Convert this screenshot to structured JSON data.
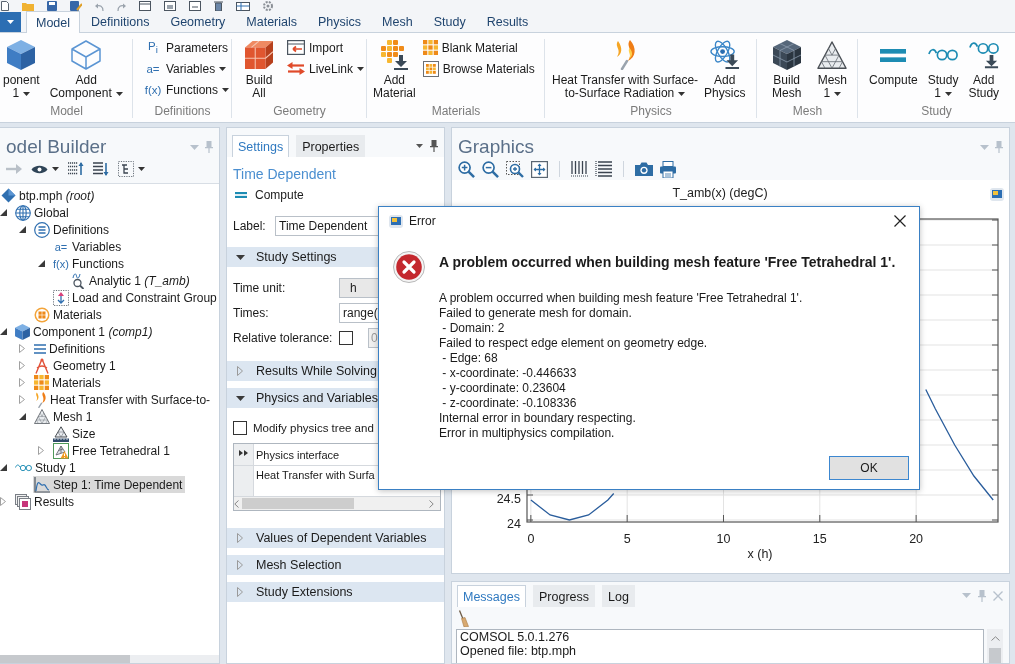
{
  "ribbon_tabs": [
    {
      "label": "Model",
      "selected": true
    },
    {
      "label": "Definitions",
      "selected": false
    },
    {
      "label": "Geometry",
      "selected": false
    },
    {
      "label": "Materials",
      "selected": false
    },
    {
      "label": "Physics",
      "selected": false
    },
    {
      "label": "Mesh",
      "selected": false
    },
    {
      "label": "Study",
      "selected": false
    },
    {
      "label": "Results",
      "selected": false
    }
  ],
  "ribbon_groups": [
    {
      "label": "Model",
      "items": [
        {
          "kind": "large",
          "lines": [
            "ponent",
            "1"
          ],
          "dropdown": true
        },
        {
          "kind": "large",
          "lines": [
            "Add",
            "Component"
          ],
          "dropdown": true
        }
      ]
    },
    {
      "label": "Definitions",
      "items": [
        {
          "kind": "stack",
          "buttons": [
            {
              "symbol": "P$_{i}$",
              "label": "Parameters",
              "dropdown": false
            },
            {
              "symbol": "a=",
              "label": "Variables",
              "dropdown": true
            },
            {
              "symbol": "f(x)",
              "label": "Functions",
              "dropdown": true
            }
          ]
        }
      ]
    },
    {
      "label": "Geometry",
      "items": [
        {
          "kind": "large",
          "lines": [
            "Build",
            "All"
          ],
          "dropdown": false
        },
        {
          "kind": "stack",
          "buttons": [
            {
              "label": "Import",
              "dropdown": false
            },
            {
              "label": "LiveLink",
              "dropdown": true
            }
          ]
        }
      ]
    },
    {
      "label": "Materials",
      "items": [
        {
          "kind": "large",
          "lines": [
            "Add",
            "Material"
          ],
          "dropdown": false
        },
        {
          "kind": "stack",
          "buttons": [
            {
              "label": "Blank Material",
              "dropdown": false
            },
            {
              "label": "Browse Materials",
              "dropdown": false
            }
          ]
        }
      ]
    },
    {
      "label": "Physics",
      "items": [
        {
          "kind": "large",
          "lines": [
            "Heat Transfer with Surface-",
            "to-Surface Radiation"
          ],
          "dropdown": true
        },
        {
          "kind": "large",
          "lines": [
            "Add",
            "Physics"
          ],
          "dropdown": false
        }
      ]
    },
    {
      "label": "Mesh",
      "items": [
        {
          "kind": "large",
          "lines": [
            "Build",
            "Mesh"
          ],
          "dropdown": false
        },
        {
          "kind": "large",
          "lines": [
            "Mesh",
            "1"
          ],
          "dropdown": true
        }
      ]
    },
    {
      "label": "Study",
      "items": [
        {
          "kind": "large",
          "lines": [
            "Compute"
          ],
          "dropdown": false
        },
        {
          "kind": "large",
          "lines": [
            "Study",
            "1"
          ],
          "dropdown": true
        },
        {
          "kind": "large",
          "lines": [
            "Add",
            "Study"
          ],
          "dropdown": false
        }
      ]
    }
  ],
  "model_builder": {
    "title": "odel Builder",
    "tree": [
      {
        "label": "btp.mph *(root)*",
        "kind": "file",
        "selected": false,
        "children": [
          {
            "label": "Global",
            "kind": "global",
            "expanded": true,
            "selected": false,
            "children": [
              {
                "label": "Definitions",
                "kind": "global_definitions",
                "expanded": true,
                "selected": false,
                "children": [
                  {
                    "label": "Variables",
                    "symbol": "a=",
                    "kind": "variables",
                    "selected": false
                  },
                  {
                    "label": "Functions",
                    "symbol": "f(x)",
                    "kind": "functions",
                    "expanded": true,
                    "selected": false,
                    "children": [
                      {
                        "label": "Analytic 1 *(T_amb)*",
                        "kind": "analytic",
                        "selected": false
                      }
                    ]
                  },
                  {
                    "label": "Load and Constraint Group",
                    "kind": "load_group",
                    "selected": false
                  }
                ]
              },
              {
                "label": "Materials",
                "kind": "global_materials",
                "selected": false
              }
            ]
          },
          {
            "label": "Component 1 *(comp1)*",
            "kind": "component",
            "expanded": true,
            "selected": false,
            "children": [
              {
                "label": "Definitions",
                "kind": "definitions",
                "expanded": false,
                "selected": false
              },
              {
                "label": "Geometry 1",
                "kind": "geometry",
                "expanded": false,
                "selected": false
              },
              {
                "label": "Materials",
                "kind": "materials",
                "expanded": false,
                "selected": false
              },
              {
                "label": "Heat Transfer with Surface-to-",
                "kind": "physics",
                "expanded": false,
                "selected": false
              },
              {
                "label": "Mesh 1",
                "kind": "mesh",
                "expanded": true,
                "selected": false,
                "children": [
                  {
                    "label": "Size",
                    "kind": "size",
                    "selected": false
                  },
                  {
                    "label": "Free Tetrahedral 1",
                    "kind": "free_tetrahedral",
                    "expanded": false,
                    "selected": false
                  }
                ]
              }
            ]
          },
          {
            "label": "Study 1",
            "kind": "study",
            "expanded": true,
            "selected": false,
            "children": [
              {
                "label": "Step 1: Time Dependent",
                "kind": "study_step",
                "selected": true
              }
            ]
          },
          {
            "label": "Results",
            "kind": "results",
            "expanded": false,
            "selected": false
          }
        ]
      }
    ]
  },
  "settings": {
    "tabs": [
      {
        "label": "Settings",
        "selected": true
      },
      {
        "label": "Properties",
        "selected": false
      }
    ],
    "title": "Time Dependent",
    "action": "Compute",
    "label_field": {
      "label": "Label:",
      "value": "Time Dependent"
    },
    "sections": [
      {
        "title": "Study Settings",
        "expanded": true,
        "fields": [
          {
            "kind": "select",
            "label": "Time unit:",
            "value": "h"
          },
          {
            "kind": "text",
            "label": "Times:",
            "value": "range("
          },
          {
            "kind": "checkbox",
            "label": "Relative tolerance:",
            "checked": false,
            "value": "0",
            "disabled": true
          }
        ]
      },
      {
        "title": "Results While Solving",
        "expanded": false
      },
      {
        "title": "Physics and Variables",
        "expanded": true,
        "option": {
          "label": "Modify physics tree and",
          "checked": false
        },
        "table": {
          "columns": [
            "Physics interface"
          ],
          "rows": [
            [
              "Heat Transfer with Surfa"
            ]
          ]
        }
      },
      {
        "title": "Values of Dependent Variables",
        "expanded": false
      },
      {
        "title": "Mesh Selection",
        "expanded": false
      },
      {
        "title": "Study Extensions",
        "expanded": false
      }
    ]
  },
  "graphics": {
    "title": "Graphics",
    "chart_data": {
      "type": "line",
      "title": "T_amb(x) (degC)",
      "xlabel": "x (h)",
      "x": [
        0,
        1,
        2,
        3,
        4,
        4.3,
        5,
        20,
        20.5,
        21,
        22,
        23,
        24
      ],
      "values": [
        24.4,
        24.1,
        24.0,
        24.1,
        24.4,
        24.53,
        null,
        null,
        26.61,
        26.22,
        25.5,
        24.88,
        24.4
      ],
      "xlim": [
        -0.2,
        24.25
      ],
      "ylim": [
        23.96,
        30.02
      ],
      "xticks": [
        0,
        5,
        10,
        15,
        20
      ],
      "yticks": [
        24,
        24.5
      ],
      "grid": true
    }
  },
  "messages": {
    "tabs": [
      {
        "label": "Messages",
        "selected": true
      },
      {
        "label": "Progress",
        "selected": false
      },
      {
        "label": "Log",
        "selected": false
      }
    ],
    "lines": [
      "COMSOL 5.0.1.276",
      "Opened file: btp.mph"
    ]
  },
  "dialog": {
    "title": "Error",
    "heading": "A problem occurred when building mesh feature 'Free Tetrahedral 1'.",
    "lines": [
      "A problem occurred when building mesh feature 'Free Tetrahedral 1'.",
      "Failed to generate mesh for domain.",
      " - Domain: 2",
      "Failed to respect edge element on geometry edge.",
      " - Edge: 68",
      " - x-coordinate: -0.446633",
      " - y-coordinate: 0.23604",
      " - z-coordinate: -0.108336",
      "Internal error in boundary respecting.",
      "Error in multiphysics compilation."
    ],
    "button": "OK"
  }
}
